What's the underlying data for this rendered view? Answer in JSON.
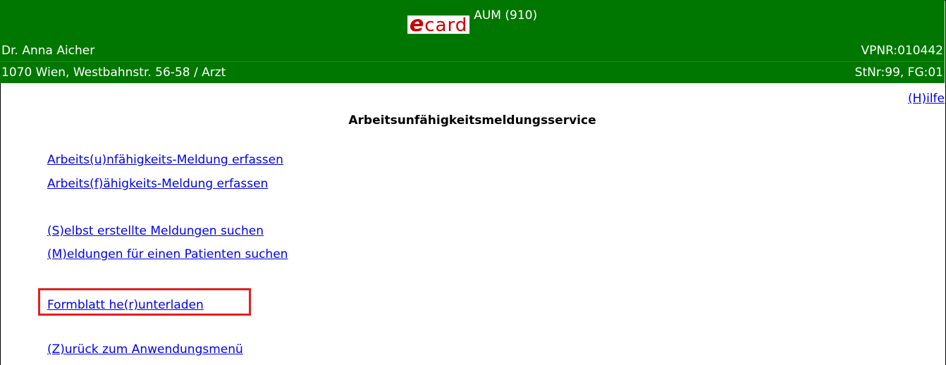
{
  "header": {
    "logo_e": "e",
    "logo_card": "card",
    "app_code": "AUM (910)",
    "doctor_name": "Dr. Anna Aicher",
    "address": "1070 Wien, Westbahnstr. 56-58 / Arzt",
    "vpnr": "VPNR:010442",
    "station": "StNr:99, FG:01",
    "bg_color": "#007700"
  },
  "help": {
    "label": "(H)ilfe"
  },
  "page": {
    "title": "Arbeitsunfähigkeitsmeldungsservice"
  },
  "menu": {
    "items": [
      {
        "label": "Arbeits(u)nfähigkeits-Meldung erfassen"
      },
      {
        "label": "Arbeits(f)ähigkeits-Meldung erfassen"
      },
      {
        "label": "(S)elbst erstellte Meldungen suchen"
      },
      {
        "label": "(M)eldungen für einen Patienten suchen"
      },
      {
        "label": "Formblatt he(r)unterladen",
        "highlighted": true
      },
      {
        "label": "(Z)urück zum Anwendungsmenü"
      }
    ]
  },
  "colors": {
    "link": "#0000ee",
    "highlight": "#e02020"
  }
}
